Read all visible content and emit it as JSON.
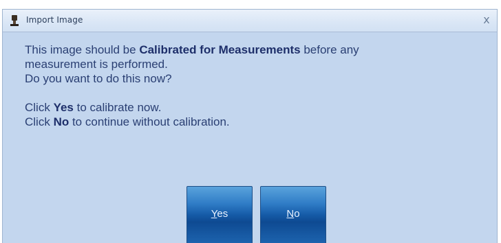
{
  "window": {
    "title": "Import Image",
    "close_glyph": "x"
  },
  "message": {
    "line1_pre": "This image should be ",
    "line1_bold": "Calibrated for Measurements",
    "line1_post": " before any",
    "line2": "measurement is performed.",
    "line3": "Do you want to do this now?",
    "line4_pre": "Click ",
    "line4_bold": "Yes",
    "line4_post": " to calibrate now.",
    "line5_pre": "Click ",
    "line5_bold": "No",
    "line5_post": " to continue without calibration."
  },
  "buttons": {
    "yes_accel": "Y",
    "yes_rest": "es",
    "no_accel": "N",
    "no_rest": "o"
  },
  "colors": {
    "dialog_background": "#c3d6ee",
    "text": "#2a3f73",
    "button": "#155aa6"
  },
  "icons": {
    "app": "app-icon",
    "close": "close-icon"
  }
}
